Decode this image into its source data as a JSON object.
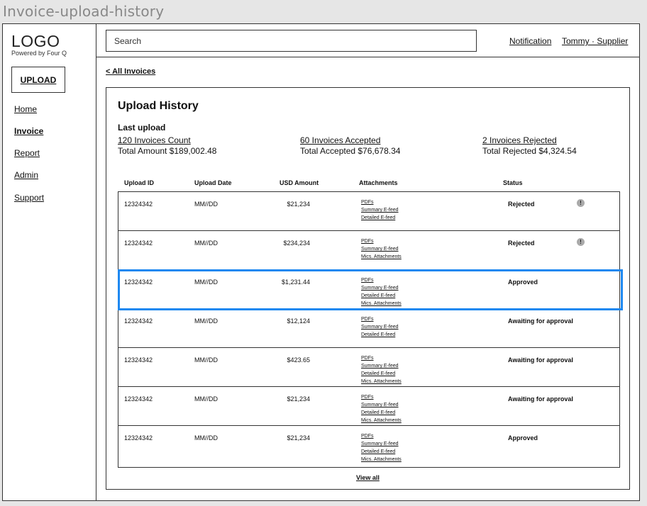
{
  "frame_title": "Invoice-upload-history",
  "sidebar": {
    "logo": "LOGO",
    "powered_by": "Powered by Four Q",
    "upload_label": "UPLOAD",
    "items": [
      {
        "label": "Home"
      },
      {
        "label": "Invoice"
      },
      {
        "label": "Report"
      },
      {
        "label": "Admin"
      },
      {
        "label": "Support"
      }
    ]
  },
  "topbar": {
    "search_placeholder": "Search",
    "notification": "Notification",
    "user": "Tommy · Supplier"
  },
  "breadcrumb": "< All Invoices",
  "panel": {
    "title": "Upload History",
    "last_upload": "Last upload",
    "stats": [
      {
        "link": "120 Invoices Count",
        "sub": "Total Amount $189,002.48"
      },
      {
        "link": "60 Invoices Accepted",
        "sub": "Total Accepted $76,678.34"
      },
      {
        "link": "2 Invoices Rejected",
        "sub": "Total Rejected $4,324.54"
      }
    ]
  },
  "table": {
    "headers": [
      "Upload ID",
      "Upload Date",
      "USD Amount",
      "Attachments",
      "Status"
    ],
    "rows": [
      {
        "id": "12324342",
        "date": "MM//DD",
        "amount": "$21,234",
        "attachments": [
          "PDFs",
          "Summary E-feed",
          "Detailed E-feed"
        ],
        "status": "Rejected",
        "warning": "!"
      },
      {
        "id": "12324342",
        "date": "MM//DD",
        "amount": "$234,234",
        "attachments": [
          "PDFs",
          "Summary E-feed",
          "Mics. Attachments"
        ],
        "status": "Rejected",
        "warning": "!"
      },
      {
        "id": "12324342",
        "date": "MM//DD",
        "amount": "$1,231.44",
        "attachments": [
          "PDFs",
          "Summary E-feed",
          "Detailed E-feed",
          "Mics. Attachments"
        ],
        "status": "Approved"
      },
      {
        "id": "12324342",
        "date": "MM//DD",
        "amount": "$12,124",
        "attachments": [
          "PDFs",
          "Summary E-feed",
          "Detailed E-feed"
        ],
        "status": "Awaiting for approval"
      },
      {
        "id": "12324342",
        "date": "MM//DD",
        "amount": "$423.65",
        "attachments": [
          "PDFs",
          "Summary E-feed",
          "Detailed E-feed",
          "Mics. Attachments"
        ],
        "status": "Awaiting for approval"
      },
      {
        "id": "12324342",
        "date": "MM//DD",
        "amount": "$21,234",
        "attachments": [
          "PDFs",
          "Summary E-feed",
          "Detailed E-feed",
          "Mics. Attachments"
        ],
        "status": "Awaiting for approval"
      },
      {
        "id": "12324342",
        "date": "MM//DD",
        "amount": "$21,234",
        "attachments": [
          "PDFs",
          "Summary E-feed",
          "Detailed E-feed",
          "Mics. Attachments"
        ],
        "status": "Approved"
      }
    ],
    "view_all": "View all"
  },
  "colors": {
    "highlight": "#1e88f0",
    "warning_badge": "#aaaaaa"
  }
}
